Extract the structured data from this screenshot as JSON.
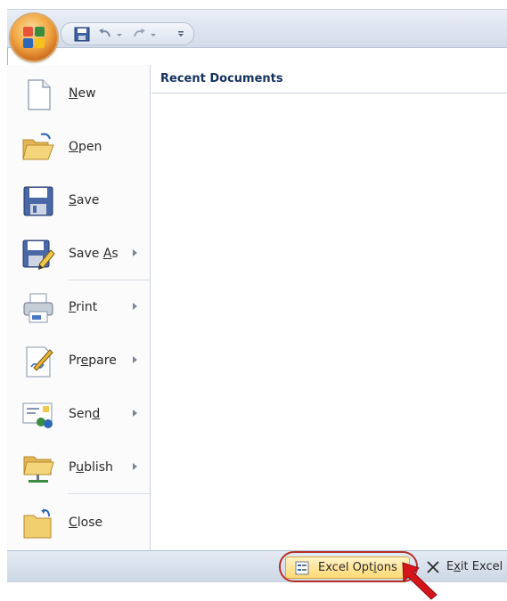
{
  "menu": {
    "commands": [
      {
        "id": "new",
        "pre": "",
        "hot": "N",
        "post": "ew",
        "submenu": false
      },
      {
        "id": "open",
        "pre": "",
        "hot": "O",
        "post": "pen",
        "submenu": false
      },
      {
        "id": "save",
        "pre": "",
        "hot": "S",
        "post": "ave",
        "submenu": false
      },
      {
        "id": "save-as",
        "pre": "Save ",
        "hot": "A",
        "post": "s",
        "submenu": true
      },
      {
        "id": "print",
        "pre": "",
        "hot": "P",
        "post": "rint",
        "submenu": true
      },
      {
        "id": "prepare",
        "pre": "Pr",
        "hot": "e",
        "post": "pare",
        "submenu": true
      },
      {
        "id": "send",
        "pre": "Sen",
        "hot": "d",
        "post": "",
        "submenu": true
      },
      {
        "id": "publish",
        "pre": "P",
        "hot": "u",
        "post": "blish",
        "submenu": true
      },
      {
        "id": "close",
        "pre": "",
        "hot": "C",
        "post": "lose",
        "submenu": false
      }
    ],
    "recent_title": "Recent Documents"
  },
  "bottom": {
    "options": {
      "pre": "Excel Opt",
      "hot": "i",
      "post": "ons"
    },
    "exit": {
      "pre": "E",
      "hot": "x",
      "post": "it Excel"
    }
  },
  "colors": {
    "office_button": "#f2a743",
    "highlight_ring": "#b5302a",
    "arrow": "#d4161b",
    "options_button": "#ffd973"
  }
}
